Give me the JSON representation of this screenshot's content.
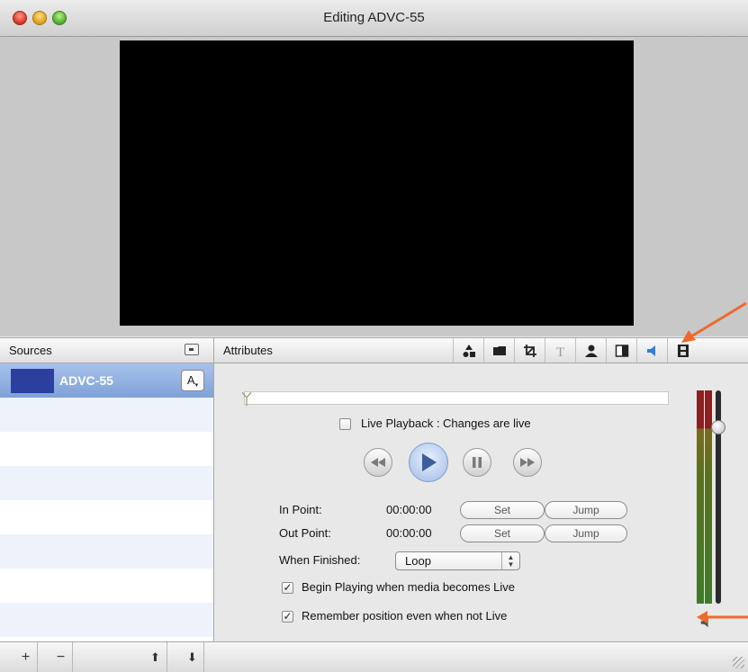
{
  "window": {
    "title": "Editing ADVC-55"
  },
  "sources": {
    "header": "Sources",
    "items": [
      {
        "name": "ADVC-55",
        "badge": "A"
      }
    ],
    "buttons": {
      "add": "+",
      "remove": "−",
      "move_up": "⬆",
      "move_down": "⬇"
    }
  },
  "attributes": {
    "header": "Attributes",
    "tabs": [
      {
        "name": "shapes",
        "icon": "shapes-icon"
      },
      {
        "name": "folder",
        "icon": "folder-icon"
      },
      {
        "name": "crop",
        "icon": "crop-icon"
      },
      {
        "name": "text",
        "icon": "text-icon",
        "glyph": "T"
      },
      {
        "name": "person",
        "icon": "person-icon"
      },
      {
        "name": "split",
        "icon": "split-icon"
      },
      {
        "name": "audio",
        "icon": "speaker-icon",
        "active": true
      },
      {
        "name": "film",
        "icon": "film-icon"
      }
    ]
  },
  "player": {
    "live_playback_label": "Live Playback : Changes are live",
    "live_playback_checked": false,
    "in_point_label": "In Point:",
    "in_point_value": "00:00:00",
    "out_point_label": "Out Point:",
    "out_point_value": "00:00:00",
    "set_label": "Set",
    "jump_label": "Jump",
    "when_finished_label": "When Finished:",
    "when_finished_value": "Loop",
    "begin_playing_label": "Begin Playing when media becomes Live",
    "begin_playing_checked": true,
    "remember_position_label": "Remember position even when not Live",
    "remember_position_checked": true,
    "check_mark": "✓"
  },
  "audio": {
    "volume_level": 0.85
  },
  "colors": {
    "accent_arrow": "#ee6a2c",
    "selection": "#7fa1d9",
    "thumbnail": "#2c3f9f"
  }
}
